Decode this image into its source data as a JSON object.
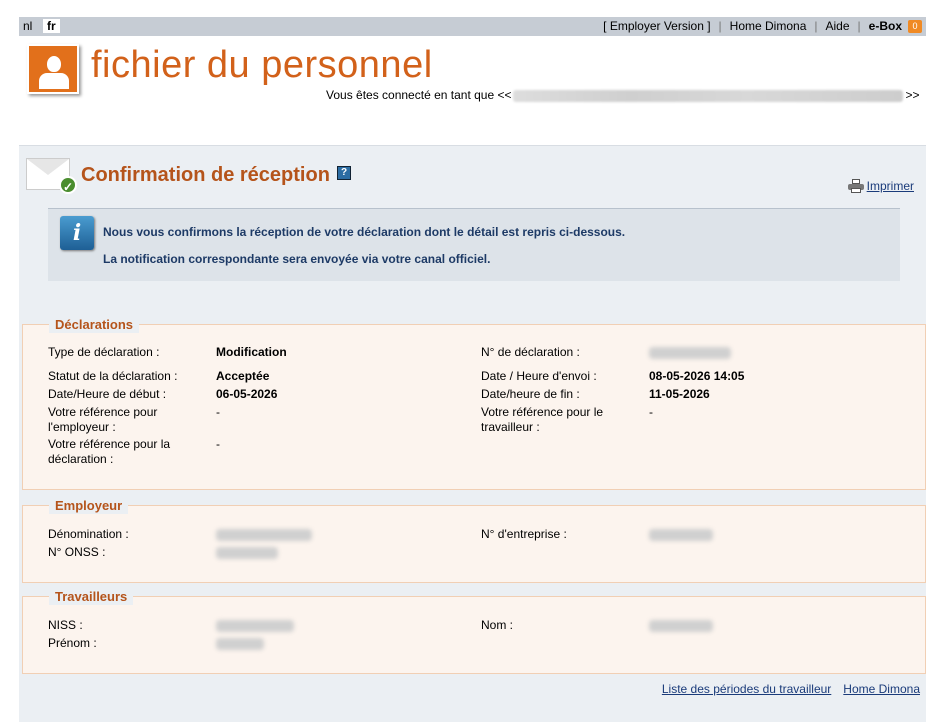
{
  "topbar": {
    "lang_nl": "nl",
    "lang_fr": "fr",
    "employer_version": "[ Employer Version ]",
    "home_dimona": "Home Dimona",
    "aide": "Aide",
    "ebox": "e-Box",
    "ebox_count": "0"
  },
  "header": {
    "logo_title": "fichier du personnel",
    "connected_prefix": "Vous êtes connecté en tant que <<",
    "connected_suffix": ">>"
  },
  "confirmation": {
    "title": "Confirmation de réception",
    "help": "?",
    "print": "Imprimer",
    "info_icon": "i",
    "info_line1": "Nous vous confirmons la réception de votre déclaration dont le détail est repris ci-dessous.",
    "info_line2": "La notification correspondante sera envoyée via votre canal officiel."
  },
  "declarations": {
    "legend": "Déclarations",
    "type_label": "Type de déclaration :",
    "type_value": "Modification",
    "num_label": "N° de déclaration :",
    "statut_label": "Statut de la déclaration :",
    "statut_value": "Acceptée",
    "envoi_label": "Date / Heure d'envoi :",
    "envoi_value": "08-05-2026 14:05",
    "debut_label": "Date/Heure de début :",
    "debut_value": "06-05-2026",
    "fin_label": "Date/heure de fin :",
    "fin_value": "11-05-2026",
    "ref_emp_label": "Votre référence pour l'employeur :",
    "ref_emp_value": "-",
    "ref_trav_label": "Votre référence pour le travailleur :",
    "ref_trav_value": "-",
    "ref_decl_label": "Votre référence pour la déclaration :",
    "ref_decl_value": "-"
  },
  "employeur": {
    "legend": "Employeur",
    "denomination_label": "Dénomination :",
    "entreprise_label": "N° d'entreprise :",
    "onss_label": "N° ONSS :"
  },
  "travailleurs": {
    "legend": "Travailleurs",
    "niss_label": "NISS :",
    "nom_label": "Nom :",
    "prenom_label": "Prénom :"
  },
  "footer": {
    "periodes_link": "Liste des périodes du travailleur",
    "home_link": "Home Dimona"
  },
  "colors": {
    "accent": "#d2611a",
    "title": "#b5541b",
    "link": "#1a3b7a"
  }
}
